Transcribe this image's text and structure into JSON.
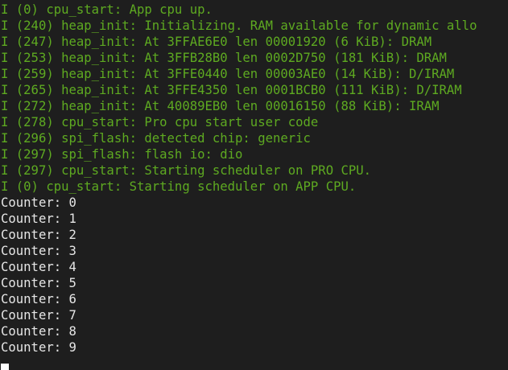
{
  "colors": {
    "background": "#1e1e1e",
    "log_text": "#5eaa21",
    "output_text": "#e6e6e6",
    "cursor": "#ffffff"
  },
  "log_lines": [
    "I (0) cpu_start: App cpu up.",
    "I (240) heap_init: Initializing. RAM available for dynamic allo",
    "I (247) heap_init: At 3FFAE6E0 len 00001920 (6 KiB): DRAM",
    "I (253) heap_init: At 3FFB28B0 len 0002D750 (181 KiB): DRAM",
    "I (259) heap_init: At 3FFE0440 len 00003AE0 (14 KiB): D/IRAM",
    "I (265) heap_init: At 3FFE4350 len 0001BCB0 (111 KiB): D/IRAM",
    "I (272) heap_init: At 40089EB0 len 00016150 (88 KiB): IRAM",
    "I (278) cpu_start: Pro cpu start user code",
    "I (296) spi_flash: detected chip: generic",
    "I (297) spi_flash: flash io: dio",
    "I (297) cpu_start: Starting scheduler on PRO CPU.",
    "I (0) cpu_start: Starting scheduler on APP CPU."
  ],
  "output_lines": [
    "Counter: 0",
    "Counter: 1",
    "Counter: 2",
    "Counter: 3",
    "Counter: 4",
    "Counter: 5",
    "Counter: 6",
    "Counter: 7",
    "Counter: 8",
    "Counter: 9"
  ]
}
